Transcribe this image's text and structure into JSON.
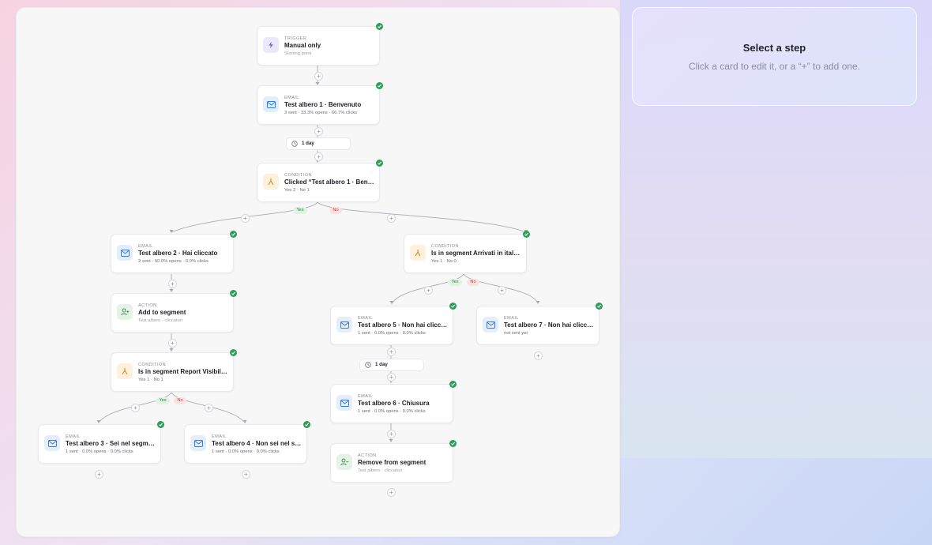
{
  "panel": {
    "title": "Select a step",
    "subtitle": "Click a card to edit it, or a “+” to add one."
  },
  "steps": {
    "trigger": {
      "type": "TRIGGER",
      "title": "Manual only",
      "meta": "Starting point",
      "icon": "bolt-icon"
    },
    "email1": {
      "type": "EMAIL",
      "title": "Test albero 1 · Benvenuto",
      "meta": "3 sent · 33.3% opens · 66.7% clicks",
      "icon": "mail-icon"
    },
    "delay1": {
      "label": "1 day",
      "icon": "clock-icon"
    },
    "cond1": {
      "type": "CONDITION",
      "title": "Clicked “Test albero 1 · Benve...",
      "meta": "Yes 2 · No 1",
      "icon": "branch-icon"
    },
    "email2": {
      "type": "EMAIL",
      "title": "Test albero 2 · Hai cliccato",
      "meta": "2 sent · 50.0% opens · 0.0% clicks",
      "icon": "mail-icon"
    },
    "action1": {
      "type": "ACTION",
      "title": "Add to segment",
      "meta": "Test albero · cliccatori",
      "icon": "user-plus-icon"
    },
    "cond2": {
      "type": "CONDITION",
      "title": "Is in segment Report Visibilit...",
      "meta": "Yes 1 · No 1",
      "icon": "branch-icon"
    },
    "email3": {
      "type": "EMAIL",
      "title": "Test albero 3 · Sei nel segmen...",
      "meta": "1 sent · 0.0% opens · 0.0% clicks",
      "icon": "mail-icon"
    },
    "email4": {
      "type": "EMAIL",
      "title": "Test albero 4 · Non sei nel seg...",
      "meta": "1 sent · 0.0% opens · 0.0% clicks",
      "icon": "mail-icon"
    },
    "cond3": {
      "type": "CONDITION",
      "title": "Is in segment Arrivati in italia...",
      "meta": "Yes 1 · No 0",
      "icon": "branch-icon"
    },
    "email5": {
      "type": "EMAIL",
      "title": "Test albero 5 · Non hai cliccat...",
      "meta": "1 sent · 0.0% opens · 0.0% clicks",
      "icon": "mail-icon"
    },
    "email7": {
      "type": "EMAIL",
      "title": "Test albero 7 · Non hai cliccat...",
      "meta": "not sent yet",
      "icon": "mail-icon"
    },
    "delay2": {
      "label": "1 day",
      "icon": "clock-icon"
    },
    "email6": {
      "type": "EMAIL",
      "title": "Test albero 6 · Chiusura",
      "meta": "1 sent · 0.0% opens · 0.0% clicks",
      "icon": "mail-icon"
    },
    "action2": {
      "type": "ACTION",
      "title": "Remove from segment",
      "meta": "Test albero · cliccatori",
      "icon": "user-minus-icon"
    }
  },
  "branches": {
    "yes": "Yes",
    "no": "No"
  },
  "add_label": "+",
  "colors": {
    "check": "#2f9e5b",
    "yes": "#2e7d44",
    "no": "#c0392b"
  }
}
